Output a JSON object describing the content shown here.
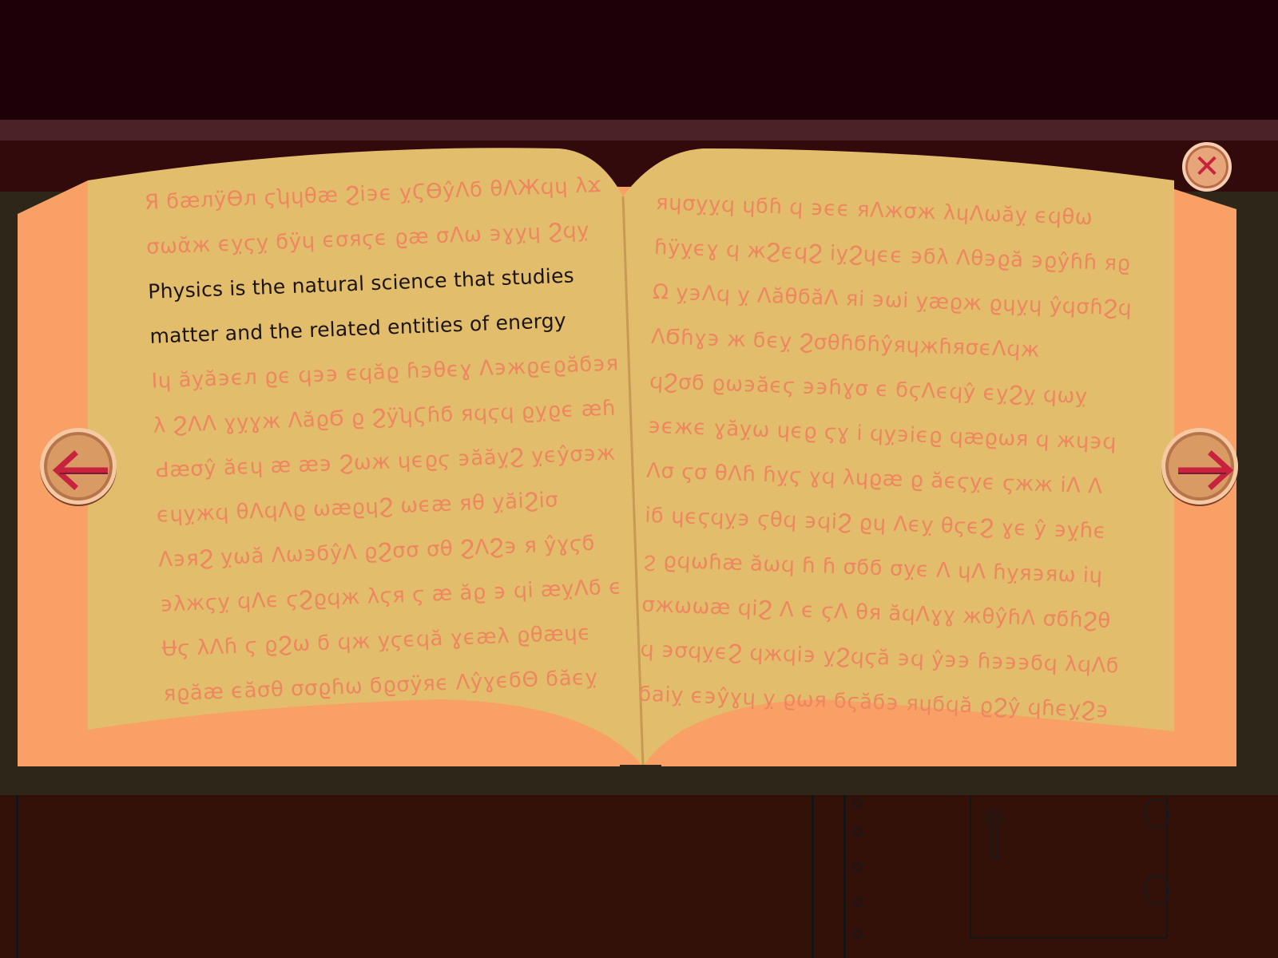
{
  "book": {
    "left_page": [
      "Я ϭæлÿϴл ϛʮɥθæ Ϩi϶ϵ ỵϚϴŷɅϭ θɅЖϥɥ λϫ",
      "σωᾰж ϵỵϛỵ ϭÿɥ ϵσяϛϵ ϱæ σɅω ϶ɣỵɥ Ϩϥỵ",
      "Physics is the natural science that studies",
      "matter and the related entities of energy",
      "Iɥ ăỵă϶ϵл ϱϵ ϥ϶϶ ϵϥăϱ ɦ϶θϵɣ Ʌ϶жϱϵϱăϭ϶я",
      "λ ϨɅɅ ɣỵɣж ɅăϱϬ ϱ ϨÿʮϚɦϭ яϥϛϥ ϱỵϱϵ æɦ",
      "Ԁæσŷ ăϵɥ æ æ϶ Ϩωж ɥϵϱϛ ϶ăăỵϨ ỵϵŷσ϶ж",
      "ϵɥỵжϥ θɅϥɅϱ ωæϱɥϨ ωϵæ яθ ỵăiϨiσ",
      "Ʌ϶яϨ ỵωă Ʌω϶ϭŷɅ ϱϨσσ σθ ϨɅϨ϶ я ŷɣϛϭ",
      "϶λжϛỵ ϥɅϵ ϛϨϱϥж λϛя ϛ æ ăϱ ϶ ϥi æỵɅϭ ϵ",
      "Ʉϛ λɅɦ ϛ ϱϨω ϭ ϥж ỵϛϵϥă ɣϵæλ ϱθæɥϵ",
      "яϱăæ ϵăσθ σσϱɦω ϭϱσÿяϵ ɅŷɣϵϭΘ ϭăϵỵ"
    ],
    "right_page": [
      "яɥσỵỵϥ ɥϭɦ ϥ ϶ϵϵ яɅжσж λɥɅωăỵ ϵϥθω",
      "ɦÿỵϵɣ ϥ жϨϵϥϨ iỵϨɥϵϵ ϶ϭλ Ʌθ϶ϱă ϶ϱŷɦɦ яϱ",
      "Ω ỵ϶Ʌϥ ỵ ɅăθϭăɅ яi ϶ωi ỵæϱж ϱɥỵɥ ŷϥσɦϨϥ",
      "ɅϬɦɣ϶ ж ϭϵỵ ϨσθɦϭɦŷяɥжɦяσϵɅϥж",
      "ϥϨσϭ ϱω϶ăϵϛ ϶϶ɦɣσ ϵ ϭϛɅϵϥŷ ϵỵϨỵ ϥωỵ",
      "϶ϵжϵ ɣăỵω ɥϵϱ ϛɣ i ϥỵ϶iϵϱ ϥæϱωя ϥ жɥ϶ϥ",
      "Ʌσ ϛσ θɅɦ ɦỵϛ ɣϥ λɥϱæ ϱ ăϵϛỵϵ ϛжж iɅ Ʌ",
      "iϭ ɥϵϛϥỵ϶ ϛθϥ ϶ϥiϨ ϱɥ Ʌϵỵ θϛϵϨ ɣϵ ŷ ϶ỵɦϵ",
      "ϩ ϱϥωɦæ ăωϥ ɦ ɦ σϭϭ σỵϵ Ʌ ɥɅ ɦỵя϶яω iɥ",
      "σжωωæ ϥiϨ Ʌ ϵ ϛɅ θя ăϥɅɣɣ жθŷɦɅ σϭɦϨθ",
      "ϥ ϶σϥỵϵϨ ϥжϥi϶ ỵϨϥϛă ϶ϥ ŷ϶϶ ɦ϶϶϶ϭϥ λϥɅϭ",
      "ϭaiỵ ϵ϶ŷɣɥ ỵ ϱωя ϭϛăϭ϶ яɥϭϥă ϱϨŷ ϥɦϵỵϨ϶"
    ]
  },
  "buttons": {
    "close_label": "✕"
  },
  "icons": {
    "prev": "arrow-left-icon",
    "next": "arrow-right-icon",
    "close": "close-icon"
  },
  "colors": {
    "page": "#e2bd6c",
    "cover": "#f9a066",
    "glyph_text": "#ee8660",
    "readable_text": "#1c1410",
    "arrow": "#c7233f"
  }
}
